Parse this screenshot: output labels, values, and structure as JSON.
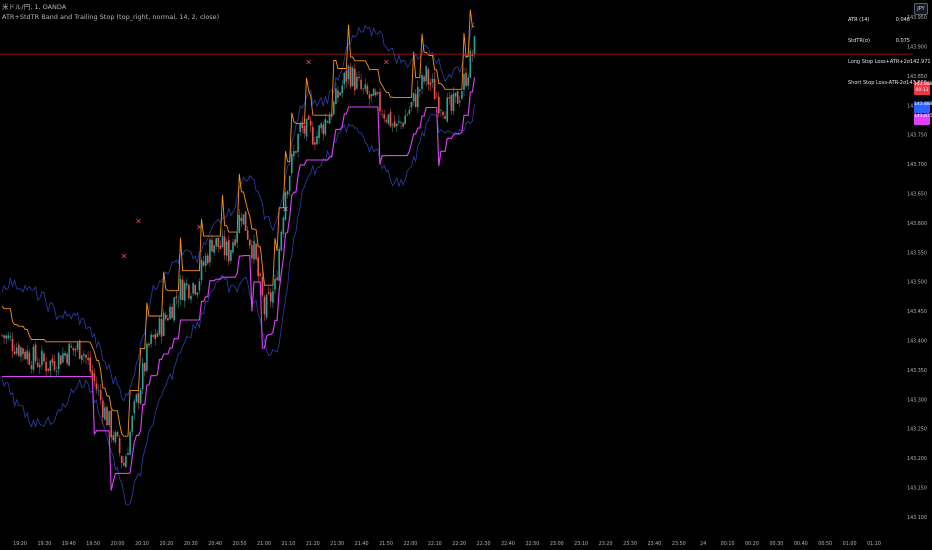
{
  "legend": {
    "symbol_line": "米ドル/円, 1, OANDA",
    "indicator_line": "ATR+StdTR Band and Trailing Stop (top_right, normal, 14, 2, close)"
  },
  "stats_table": [
    {
      "label": "ATR (14)",
      "formula": "",
      "value": "0.046"
    },
    {
      "label": "StdTR(σ)",
      "formula": "",
      "value": "0.075"
    },
    {
      "label": "Long Stop Loss",
      "formula": "+ATR+2σ",
      "value": "142.971"
    },
    {
      "label": "Short Stop Loss",
      "formula": "-ATR-2σ",
      "value": "143.899"
    }
  ],
  "currency_button": "JPY",
  "price_tags": [
    {
      "name": "last-price",
      "text": "143.888 00:13",
      "color": "#f23645"
    },
    {
      "name": "long-stop",
      "text": "143.888",
      "color": "#2962ff"
    },
    {
      "name": "short-stop",
      "text": "143.875",
      "color": "#e040fb"
    }
  ],
  "price_axis_labels": [
    "143.950",
    "143.900",
    "143.850",
    "143.800",
    "143.750",
    "143.700",
    "143.650",
    "143.600",
    "143.550",
    "143.500",
    "143.450",
    "143.400",
    "143.350",
    "143.300",
    "143.250",
    "143.200",
    "143.150",
    "143.100"
  ],
  "time_axis_labels": [
    "19:20",
    "19:30",
    "19:40",
    "19:50",
    "20:00",
    "20:10",
    "20:20",
    "20:30",
    "20:40",
    "20:50",
    "21:00",
    "21:10",
    "21:20",
    "21:30",
    "21:40",
    "21:50",
    "22:00",
    "22:10",
    "22:20",
    "22:30",
    "22:40",
    "22:50",
    "23:00",
    "23:10",
    "23:20",
    "23:30",
    "23:40",
    "23:50",
    "24",
    "00:10",
    "00:20",
    "00:30",
    "00:40",
    "00:50",
    "01:00",
    "01:10"
  ],
  "colors": {
    "background": "#000000",
    "up_candle": "#26a69a",
    "down_candle": "#ef5350",
    "band": "#2c3ea8",
    "short_stop": "#f7931a",
    "long_stop": "#e040fb",
    "price_line": "#b71c1c"
  },
  "chart_data": {
    "type": "candlestick",
    "ylim": [
      143.07,
      143.98
    ],
    "close_series_anchors": [
      [
        0,
        143.41
      ],
      [
        8,
        143.39
      ],
      [
        15,
        143.37
      ],
      [
        22,
        143.36
      ],
      [
        30,
        143.38
      ],
      [
        38,
        143.39
      ],
      [
        45,
        143.32
      ],
      [
        52,
        143.25
      ],
      [
        58,
        143.19
      ],
      [
        63,
        143.28
      ],
      [
        70,
        143.39
      ],
      [
        78,
        143.44
      ],
      [
        85,
        143.49
      ],
      [
        93,
        143.5
      ],
      [
        100,
        143.57
      ],
      [
        108,
        143.55
      ],
      [
        114,
        143.62
      ],
      [
        120,
        143.55
      ],
      [
        125,
        143.45
      ],
      [
        130,
        143.49
      ],
      [
        135,
        143.66
      ],
      [
        142,
        143.76
      ],
      [
        150,
        143.75
      ],
      [
        158,
        143.8
      ],
      [
        165,
        143.86
      ],
      [
        172,
        143.82
      ],
      [
        180,
        143.8
      ],
      [
        188,
        143.76
      ],
      [
        195,
        143.8
      ],
      [
        202,
        143.85
      ],
      [
        208,
        143.81
      ],
      [
        214,
        143.79
      ],
      [
        220,
        143.84
      ],
      [
        225,
        143.9
      ]
    ],
    "cross_markers": [
      {
        "bar": 58,
        "price": 143.54,
        "color": "#ef5350"
      },
      {
        "bar": 65,
        "price": 143.6,
        "color": "#ef5350"
      },
      {
        "bar": 94,
        "price": 143.59,
        "color": "#ef5350"
      },
      {
        "bar": 135,
        "price": 143.62,
        "color": "#b2b5be"
      },
      {
        "bar": 146,
        "price": 143.87,
        "color": "#ef5350"
      },
      {
        "bar": 183,
        "price": 143.87,
        "color": "#ef5350"
      }
    ],
    "price_line": 143.888,
    "bar_count": 226
  }
}
